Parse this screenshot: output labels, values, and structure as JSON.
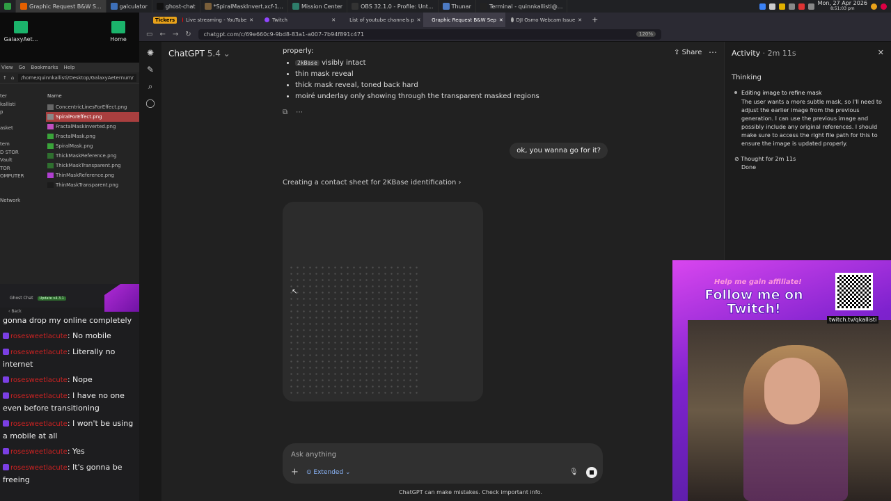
{
  "taskbar": {
    "tasks": [
      {
        "label": "Graphic Request B&W S...",
        "color": "#e66000",
        "active": true
      },
      {
        "label": "galculator",
        "color": "#3d6fb8",
        "active": false
      },
      {
        "label": "ghost-chat",
        "color": "#111111",
        "active": false
      },
      {
        "label": "*SpiralMaskInvert.xcf-1...",
        "color": "#7a5f3a",
        "active": false
      },
      {
        "label": "Mission Center",
        "color": "#2e7d6a",
        "active": false
      },
      {
        "label": "OBS 32.1.0 - Profile: Unt...",
        "color": "#333333",
        "active": false
      },
      {
        "label": "Thunar",
        "color": "#4d7bc4",
        "active": false
      },
      {
        "label": "Terminal - quinnkallisti@...",
        "color": "#222222",
        "active": false
      }
    ],
    "clock_date": "Mon, 27 Apr 2026",
    "clock_time": "8:51:03 pm"
  },
  "desktop": {
    "icons": [
      {
        "label": "GalaxyAet..."
      },
      {
        "label": "Home"
      }
    ]
  },
  "filemanager": {
    "menu": [
      "View",
      "Go",
      "Bookmarks",
      "Help"
    ],
    "path": "/home/quinnkallisti/Desktop/GalaxyAeternum/",
    "side": [
      "ter",
      "kallisti",
      "p",
      "",
      "asket",
      "",
      "tem",
      "D STOR",
      "Vault",
      "TOR",
      "OMPUTER",
      "",
      "",
      "Network"
    ],
    "column": "Name",
    "files": [
      {
        "name": "ConcentricLinesForEffect.png",
        "color": "#666666",
        "selected": false
      },
      {
        "name": "SpiralForEffect.png",
        "color": "#888888",
        "selected": true
      },
      {
        "name": "FractalMaskInverted.png",
        "color": "#c04fc0",
        "selected": false
      },
      {
        "name": "FractalMask.png",
        "color": "#3aa33a",
        "selected": false
      },
      {
        "name": "SpiralMask.png",
        "color": "#3aa33a",
        "selected": false
      },
      {
        "name": "ThickMaskReference.png",
        "color": "#2f6f2f",
        "selected": false
      },
      {
        "name": "ThickMaskTransparent.png",
        "color": "#2f6f2f",
        "selected": false
      },
      {
        "name": "ThinMaskReference.png",
        "color": "#b03fd0",
        "selected": false
      },
      {
        "name": "ThinMaskTransparent.png",
        "color": "#1b1b1b",
        "selected": false
      }
    ]
  },
  "chat": {
    "title": "Ghost Chat",
    "update_badge": "Update v4.3.1",
    "back": "Back",
    "messages": [
      {
        "user": "",
        "text": "gonna drop my online completely"
      },
      {
        "user": "rosesweetlacute",
        "text": "No mobile"
      },
      {
        "user": "rosesweetlacute",
        "text": "Literally no internet"
      },
      {
        "user": "rosesweetlacute",
        "text": "Nope"
      },
      {
        "user": "rosesweetlacute",
        "text": "I have no one even before transitioning"
      },
      {
        "user": "rosesweetlacute",
        "text": "I won't be using a mobile at all"
      },
      {
        "user": "rosesweetlacute",
        "text": "Yes"
      },
      {
        "user": "rosesweetlacute",
        "text": "It's gonna be freeing"
      }
    ]
  },
  "browser": {
    "tabs": [
      {
        "label": "Live streaming - YouTube",
        "color": "#ff0000",
        "active": false
      },
      {
        "label": "Twitch",
        "color": "#9146ff",
        "active": false
      },
      {
        "label": "List of youtube channels p",
        "color": "#cc0000",
        "active": false
      },
      {
        "label": "Graphic Request B&W Sep",
        "color": "#aaaaaa",
        "active": true
      },
      {
        "label": "DJI Osmo Webcam Issue",
        "color": "#aaaaaa",
        "active": false
      }
    ],
    "tickers_label": "Tickers",
    "url": "chatgpt.com/c/69e660c9-9bd8-83a1-a007-7b94f891c471",
    "zoom": "120%"
  },
  "chatgpt": {
    "model_name": "ChatGPT",
    "model_version": "5.4",
    "share": "Share",
    "props_intro": "properly:",
    "props": [
      {
        "code": "2kBase",
        "text": "visibly intact"
      },
      {
        "code": "",
        "text": "thin mask reveal"
      },
      {
        "code": "",
        "text": "thick mask reveal, toned back hard"
      },
      {
        "code": "",
        "text": "moiré underlay only showing through the transparent masked regions"
      }
    ],
    "user_message": "ok, you wanna go for it?",
    "contact_sheet": "Creating a contact sheet for 2KBase identification",
    "input_placeholder": "Ask anything",
    "extended": "Extended",
    "disclaimer": "ChatGPT can make mistakes. Check important info."
  },
  "activity": {
    "title": "Activity",
    "duration": "2m 11s",
    "thinking": "Thinking",
    "step_title": "Editing image to refine mask",
    "step_text": "The user wants a more subtle mask, so I'll need to adjust the earlier image from the previous generation. I can use the previous image and possibly include any original references. I should make sure to access the right file path for this to ensure the image is updated properly.",
    "thought": "Thought for 2m 11s",
    "done": "Done"
  },
  "promo": {
    "top": "Help me gain affiliate!",
    "main": "Follow me on Twitch!",
    "url": "twitch.tv/qkallisti"
  }
}
